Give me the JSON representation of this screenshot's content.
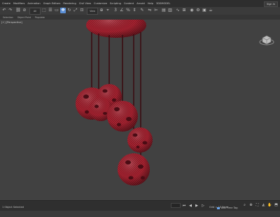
{
  "menubar": {
    "items": [
      "Create",
      "Modifiers",
      "Animation",
      "Graph Editors",
      "Rendering",
      "Civil View",
      "Customize",
      "Scripting",
      "Content",
      "Arnold",
      "Help",
      "3DSMODEL"
    ],
    "signin_label": "Sign In"
  },
  "toolbar": {
    "filter_label": "All",
    "view_label": "View"
  },
  "ribbon": {
    "labels": [
      "Selection",
      "Object Paint",
      "Populate"
    ]
  },
  "viewport": {
    "label": "[+] [Perspective]",
    "mesh_color": "#8a1b26",
    "wire_color": "#c02a3c",
    "background_color": "#414141"
  },
  "statusbar": {
    "selection_text": "1 Object Selected",
    "coords_text": "Grid = 10,0mm",
    "time_tag_label": "Add Time Tag"
  }
}
